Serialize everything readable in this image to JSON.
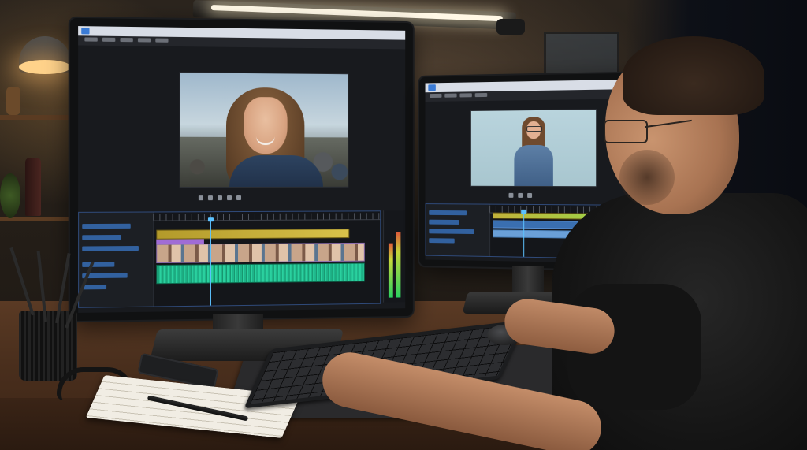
{
  "scene": {
    "description_visible_text": [],
    "left_monitor": {
      "window_title": "",
      "timecode_left": "",
      "timecode_right": ""
    },
    "right_monitor": {
      "window_title": ""
    }
  },
  "colors": {
    "timeline_border": "#2f4a7a",
    "audio_clip": "#1fb58a",
    "video_clip": "#c8a58a",
    "adjustment_clip": "#d8c24a",
    "playhead": "#5cc2ff"
  },
  "icons": [
    "desk-lamp",
    "keyboard",
    "mouse",
    "remote",
    "headphones",
    "pencil-cup",
    "notebook",
    "pen"
  ]
}
